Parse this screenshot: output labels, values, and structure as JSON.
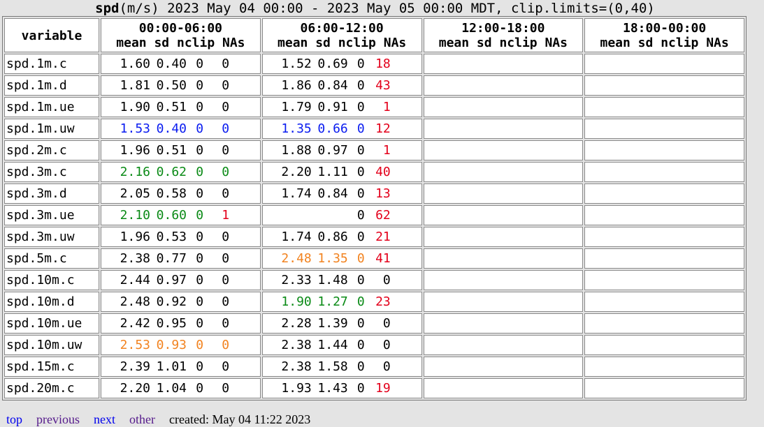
{
  "title": {
    "variable": "spd",
    "rest": "(m/s) 2023 May 04 00:00 - 2023 May 05 00:00 MDT, clip.limits=(0,40)"
  },
  "colors": {
    "default": "#000000",
    "blue": "#0a1cf0",
    "green": "#0a8a16",
    "orange": "#f28320",
    "na_red": "#e3001b"
  },
  "table": {
    "variable_header": "variable",
    "periods": [
      "00:00-06:00",
      "06:00-12:00",
      "12:00-18:00",
      "18:00-00:00"
    ],
    "subheader": "mean sd nclip NAs",
    "rows": [
      {
        "variable": "spd.1m.c",
        "p1": {
          "mean": "1.60",
          "sd": "0.40",
          "nclip": "0",
          "nas": "0",
          "color": "#000000"
        },
        "p2": {
          "mean": "1.52",
          "sd": "0.69",
          "nclip": "0",
          "nas": "18",
          "color": "#000000"
        }
      },
      {
        "variable": "spd.1m.d",
        "p1": {
          "mean": "1.81",
          "sd": "0.50",
          "nclip": "0",
          "nas": "0",
          "color": "#000000"
        },
        "p2": {
          "mean": "1.86",
          "sd": "0.84",
          "nclip": "0",
          "nas": "43",
          "color": "#000000"
        }
      },
      {
        "variable": "spd.1m.ue",
        "p1": {
          "mean": "1.90",
          "sd": "0.51",
          "nclip": "0",
          "nas": "0",
          "color": "#000000"
        },
        "p2": {
          "mean": "1.79",
          "sd": "0.91",
          "nclip": "0",
          "nas": "1",
          "color": "#000000"
        }
      },
      {
        "variable": "spd.1m.uw",
        "p1": {
          "mean": "1.53",
          "sd": "0.40",
          "nclip": "0",
          "nas": "0",
          "color": "#0a1cf0"
        },
        "p2": {
          "mean": "1.35",
          "sd": "0.66",
          "nclip": "0",
          "nas": "12",
          "color": "#0a1cf0"
        }
      },
      {
        "variable": "spd.2m.c",
        "p1": {
          "mean": "1.96",
          "sd": "0.51",
          "nclip": "0",
          "nas": "0",
          "color": "#000000"
        },
        "p2": {
          "mean": "1.88",
          "sd": "0.97",
          "nclip": "0",
          "nas": "1",
          "color": "#000000"
        }
      },
      {
        "variable": "spd.3m.c",
        "p1": {
          "mean": "2.16",
          "sd": "0.62",
          "nclip": "0",
          "nas": "0",
          "color": "#0a8a16"
        },
        "p2": {
          "mean": "2.20",
          "sd": "1.11",
          "nclip": "0",
          "nas": "40",
          "color": "#000000"
        }
      },
      {
        "variable": "spd.3m.d",
        "p1": {
          "mean": "2.05",
          "sd": "0.58",
          "nclip": "0",
          "nas": "0",
          "color": "#000000"
        },
        "p2": {
          "mean": "1.74",
          "sd": "0.84",
          "nclip": "0",
          "nas": "13",
          "color": "#000000"
        }
      },
      {
        "variable": "spd.3m.ue",
        "p1": {
          "mean": "2.10",
          "sd": "0.60",
          "nclip": "0",
          "nas": "1",
          "color": "#0a8a16"
        },
        "p2": {
          "mean": "",
          "sd": "",
          "nclip": "0",
          "nas": "62",
          "color": "#000000"
        }
      },
      {
        "variable": "spd.3m.uw",
        "p1": {
          "mean": "1.96",
          "sd": "0.53",
          "nclip": "0",
          "nas": "0",
          "color": "#000000"
        },
        "p2": {
          "mean": "1.74",
          "sd": "0.86",
          "nclip": "0",
          "nas": "21",
          "color": "#000000"
        }
      },
      {
        "variable": "spd.5m.c",
        "p1": {
          "mean": "2.38",
          "sd": "0.77",
          "nclip": "0",
          "nas": "0",
          "color": "#000000"
        },
        "p2": {
          "mean": "2.48",
          "sd": "1.35",
          "nclip": "0",
          "nas": "41",
          "color": "#f28320"
        }
      },
      {
        "variable": "spd.10m.c",
        "p1": {
          "mean": "2.44",
          "sd": "0.97",
          "nclip": "0",
          "nas": "0",
          "color": "#000000"
        },
        "p2": {
          "mean": "2.33",
          "sd": "1.48",
          "nclip": "0",
          "nas": "0",
          "color": "#000000"
        }
      },
      {
        "variable": "spd.10m.d",
        "p1": {
          "mean": "2.48",
          "sd": "0.92",
          "nclip": "0",
          "nas": "0",
          "color": "#000000"
        },
        "p2": {
          "mean": "1.90",
          "sd": "1.27",
          "nclip": "0",
          "nas": "23",
          "color": "#0a8a16"
        }
      },
      {
        "variable": "spd.10m.ue",
        "p1": {
          "mean": "2.42",
          "sd": "0.95",
          "nclip": "0",
          "nas": "0",
          "color": "#000000"
        },
        "p2": {
          "mean": "2.28",
          "sd": "1.39",
          "nclip": "0",
          "nas": "0",
          "color": "#000000"
        }
      },
      {
        "variable": "spd.10m.uw",
        "p1": {
          "mean": "2.53",
          "sd": "0.93",
          "nclip": "0",
          "nas": "0",
          "color": "#f28320"
        },
        "p2": {
          "mean": "2.38",
          "sd": "1.44",
          "nclip": "0",
          "nas": "0",
          "color": "#000000"
        }
      },
      {
        "variable": "spd.15m.c",
        "p1": {
          "mean": "2.39",
          "sd": "1.01",
          "nclip": "0",
          "nas": "0",
          "color": "#000000"
        },
        "p2": {
          "mean": "2.38",
          "sd": "1.58",
          "nclip": "0",
          "nas": "0",
          "color": "#000000"
        }
      },
      {
        "variable": "spd.20m.c",
        "p1": {
          "mean": "2.20",
          "sd": "1.04",
          "nclip": "0",
          "nas": "0",
          "color": "#000000"
        },
        "p2": {
          "mean": "1.93",
          "sd": "1.43",
          "nclip": "0",
          "nas": "19",
          "color": "#000000"
        }
      }
    ]
  },
  "footer": {
    "links": [
      "top",
      "previous",
      "next",
      "other"
    ],
    "created": "created: May 04 11:22 2023"
  }
}
